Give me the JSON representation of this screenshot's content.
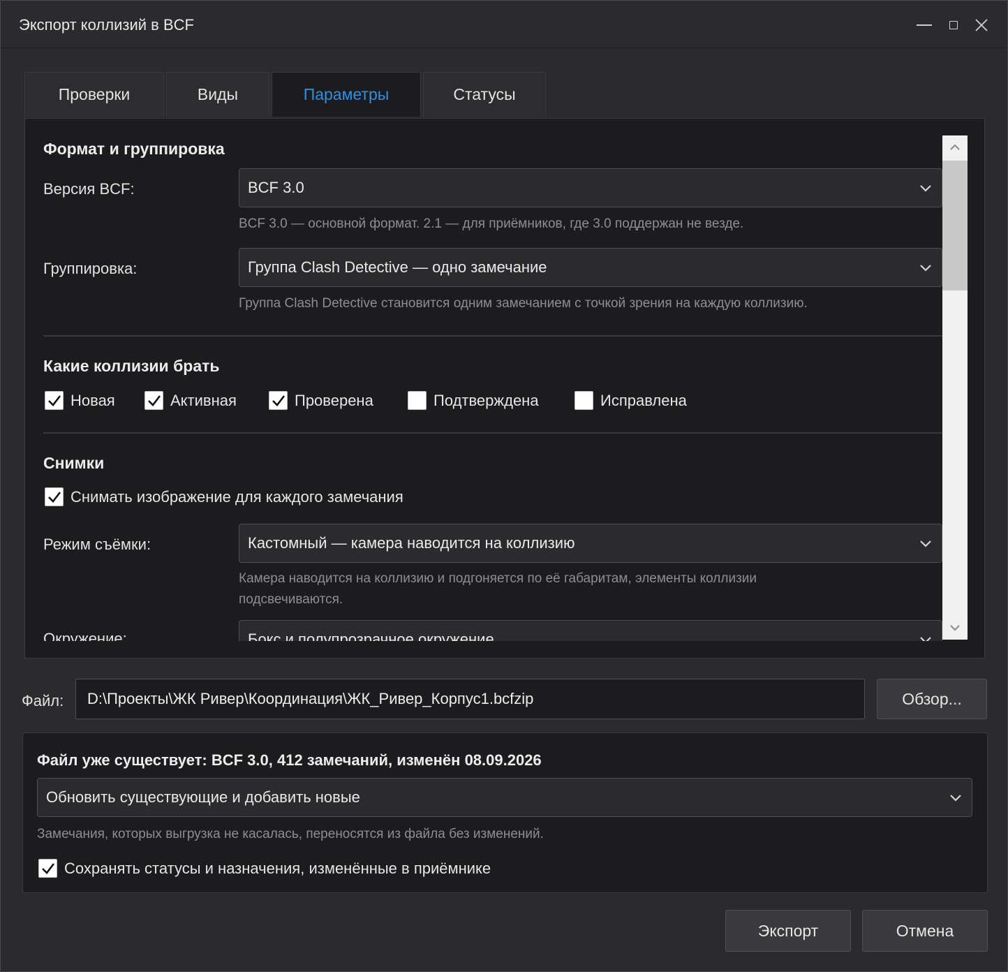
{
  "window": {
    "title": "Экспорт коллизий в BCF"
  },
  "tabs": [
    {
      "label": "Проверки",
      "active": false
    },
    {
      "label": "Виды",
      "active": false
    },
    {
      "label": "Параметры",
      "active": true
    },
    {
      "label": "Статусы",
      "active": false
    }
  ],
  "format": {
    "heading": "Формат и группировка",
    "version_label": "Версия BCF:",
    "version_value": "BCF 3.0",
    "version_hint": "BCF 3.0 — основной формат. 2.1 — для приёмников, где 3.0 поддержан не везде.",
    "grouping_label": "Группировка:",
    "grouping_value": "Группа Clash Detective — одно замечание",
    "grouping_hint": "Группа Clash Detective становится одним замечанием с точкой зрения на каждую коллизию."
  },
  "clashes": {
    "heading": "Какие коллизии брать",
    "statuses": [
      {
        "label": "Новая",
        "checked": true
      },
      {
        "label": "Активная",
        "checked": true
      },
      {
        "label": "Проверена",
        "checked": true
      },
      {
        "label": "Подтверждена",
        "checked": false
      },
      {
        "label": "Исправлена",
        "checked": false
      }
    ]
  },
  "snapshots": {
    "heading": "Снимки",
    "capture_label": "Снимать изображение для каждого замечания",
    "capture_checked": true,
    "mode_label": "Режим съёмки:",
    "mode_value": "Кастомный — камера наводится на коллизию",
    "mode_hint_line1": "Камера наводится на коллизию и подгоняется по её габаритам, элементы коллизии",
    "mode_hint_line2": "подсвечиваются.",
    "env_label": "Окружение:",
    "env_value": "Бокс и полупрозрачное окружение"
  },
  "file": {
    "label": "Файл:",
    "path": "D:\\Проекты\\ЖК Ривер\\Координация\\ЖК_Ривер_Корпус1.bcfzip",
    "browse_label": "Обзор..."
  },
  "existing": {
    "title": "Файл уже существует: BCF 3.0, 412 замечаний, изменён 08.09.2026",
    "mode_value": "Обновить существующие и добавить новые",
    "hint": "Замечания, которых выгрузка не касалась, переносятся из файла без изменений.",
    "keep_label": "Сохранять статусы и назначения, изменённые в приёмнике",
    "keep_checked": true
  },
  "actions": {
    "export_label": "Экспорт",
    "cancel_label": "Отмена"
  },
  "colors": {
    "accent": "#2f8fe0",
    "background": "#1c1c1e",
    "window": "#2b2b2d"
  }
}
